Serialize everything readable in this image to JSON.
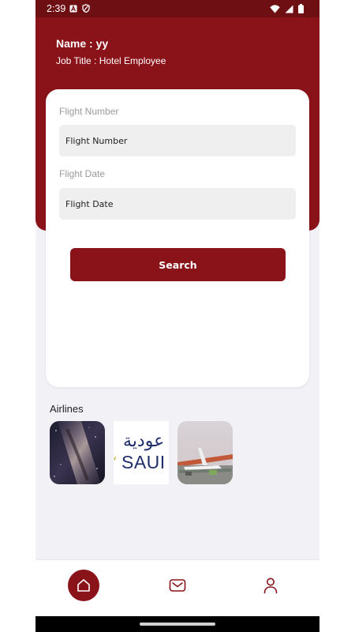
{
  "status_bar": {
    "time": "2:39",
    "left_icons": [
      "a-badge-icon",
      "shield-icon"
    ],
    "right_icons": [
      "wifi-icon",
      "signal-icon",
      "battery-icon"
    ]
  },
  "profile": {
    "name": "Name : yy",
    "job_title": "Job Title :  Hotel Employee"
  },
  "search_form": {
    "flight_number_label": "Flight Number",
    "flight_number_value": "Flight Number",
    "flight_date_label": "Flight Date",
    "flight_date_value": "Flight Date",
    "search_button": "Search"
  },
  "airlines": {
    "title": "Airlines",
    "items": [
      {
        "image": "galaxy-night-sky"
      },
      {
        "image": "saudia-logo",
        "logo_text": "SAUI",
        "arabic_text": "عودية"
      },
      {
        "image": "airport-airplane"
      }
    ]
  },
  "bottom_nav": {
    "items": [
      {
        "icon": "home-icon",
        "active": true
      },
      {
        "icon": "mail-icon",
        "active": false
      },
      {
        "icon": "profile-icon",
        "active": false
      }
    ]
  },
  "colors": {
    "primary": "#8a1219",
    "status_bar": "#6e0f14",
    "background": "#f1f1f6"
  }
}
